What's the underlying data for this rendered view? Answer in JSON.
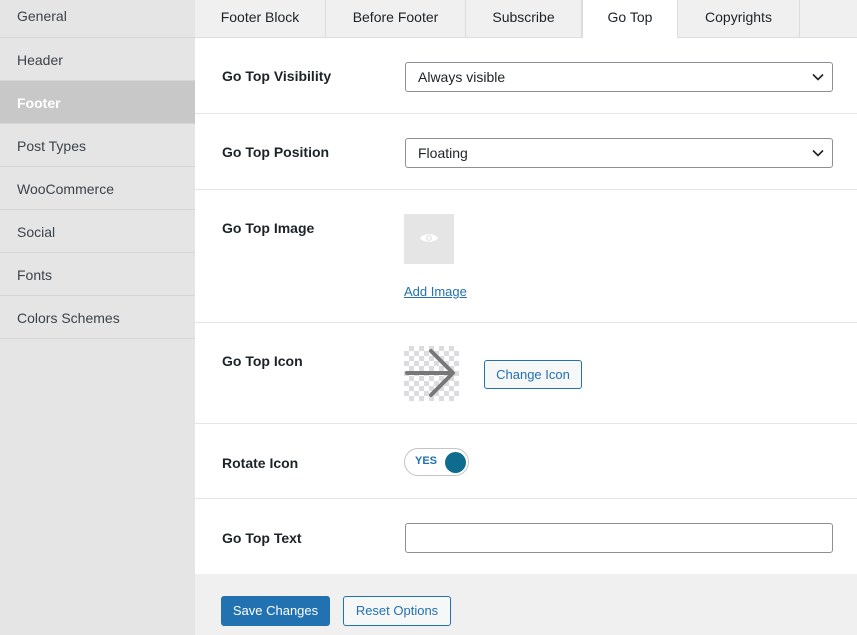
{
  "sidebar": {
    "items": [
      {
        "label": "General"
      },
      {
        "label": "Header"
      },
      {
        "label": "Footer"
      },
      {
        "label": "Post Types"
      },
      {
        "label": "WooCommerce"
      },
      {
        "label": "Social"
      },
      {
        "label": "Fonts"
      },
      {
        "label": "Colors Schemes"
      }
    ],
    "active": "Footer"
  },
  "tabs": [
    {
      "label": "Footer Block"
    },
    {
      "label": "Before Footer"
    },
    {
      "label": "Subscribe"
    },
    {
      "label": "Go Top"
    },
    {
      "label": "Copyrights"
    }
  ],
  "active_tab": "Go Top",
  "settings": {
    "visibility": {
      "label": "Go Top Visibility",
      "value": "Always visible"
    },
    "position": {
      "label": "Go Top Position",
      "value": "Floating"
    },
    "image": {
      "label": "Go Top Image",
      "link": "Add Image"
    },
    "icon": {
      "label": "Go Top Icon",
      "button": "Change Icon",
      "icon_name": "arrow-right-icon"
    },
    "rotate": {
      "label": "Rotate Icon",
      "toggle_text": "YES",
      "on": true
    },
    "text": {
      "label": "Go Top Text",
      "value": ""
    }
  },
  "actions": {
    "save": "Save Changes",
    "reset": "Reset Options"
  },
  "colors": {
    "accent": "#2271b1",
    "toggle_knob": "#0e6c8f",
    "sidebar_active": "#c8c8c8"
  }
}
